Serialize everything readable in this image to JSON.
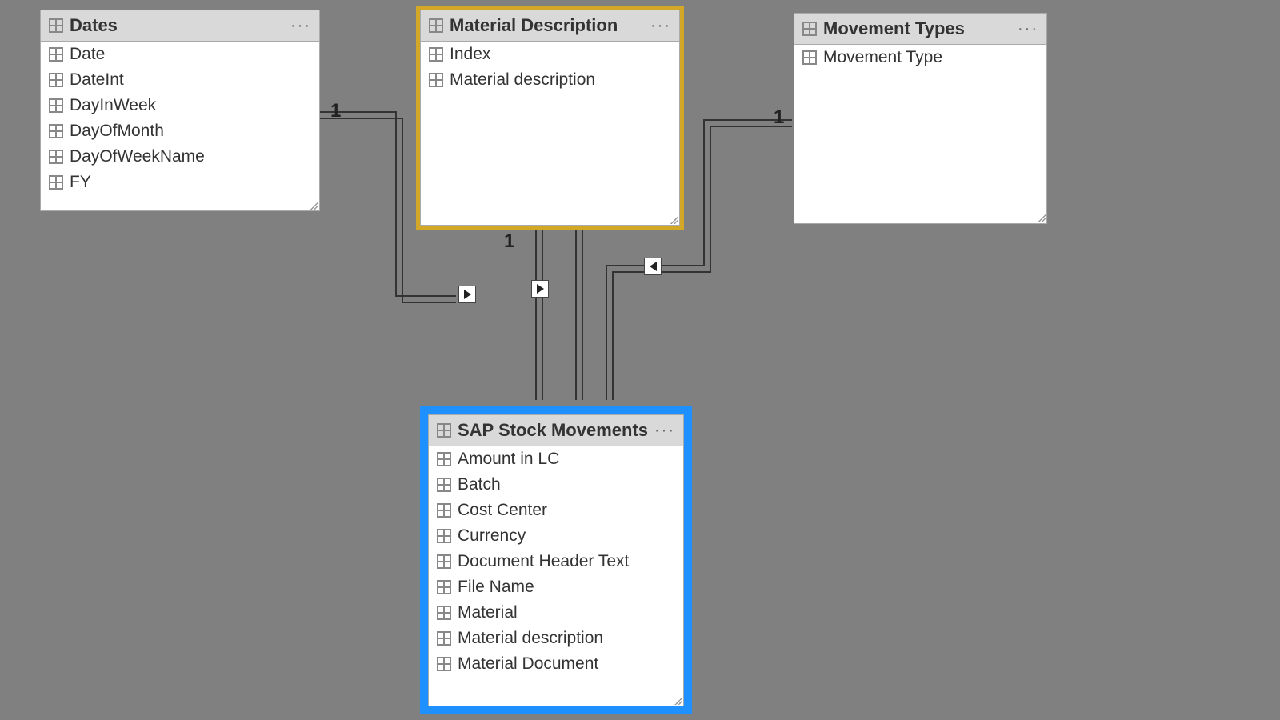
{
  "tables": {
    "dates": {
      "title": "Dates",
      "fields": [
        "Date",
        "DateInt",
        "DayInWeek",
        "DayOfMonth",
        "DayOfWeekName",
        "FY"
      ]
    },
    "material": {
      "title": "Material Description",
      "fields": [
        "Index",
        "Material description"
      ]
    },
    "movement": {
      "title": "Movement Types",
      "fields": [
        "Movement Type"
      ]
    },
    "sap": {
      "title": "SAP Stock Movements",
      "fields": [
        "Amount in LC",
        "Batch",
        "Cost Center",
        "Currency",
        "Document Header Text",
        "File Name",
        "Material",
        "Material description",
        "Material Document"
      ]
    }
  },
  "relations": {
    "dates_card": "1",
    "material_card": "1",
    "movement_card": "1"
  },
  "menu": "···"
}
